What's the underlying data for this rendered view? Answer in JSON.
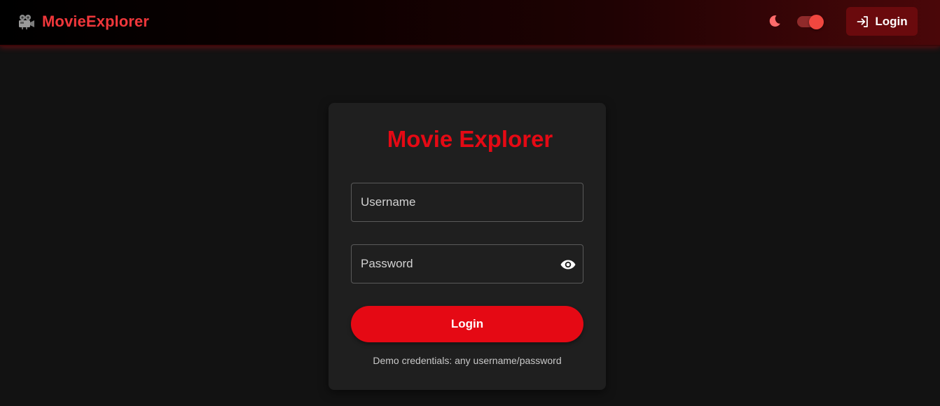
{
  "header": {
    "brand_icon": "movie-camera-icon",
    "brand_name": "MovieExplorer",
    "theme_icon": "moon-icon",
    "theme_toggle": {
      "state": "on"
    },
    "login_button": {
      "icon": "login-icon",
      "label": "Login"
    }
  },
  "login_card": {
    "title": "Movie Explorer",
    "username": {
      "placeholder": "Username",
      "value": ""
    },
    "password": {
      "placeholder": "Password",
      "value": "",
      "toggle_icon": "eye-icon"
    },
    "submit_label": "Login",
    "demo_note": "Demo credentials: any username/password"
  },
  "colors": {
    "accent": "#e50914",
    "brand_text": "#f0373b",
    "background": "#121212",
    "card": "#1f1f1f"
  }
}
